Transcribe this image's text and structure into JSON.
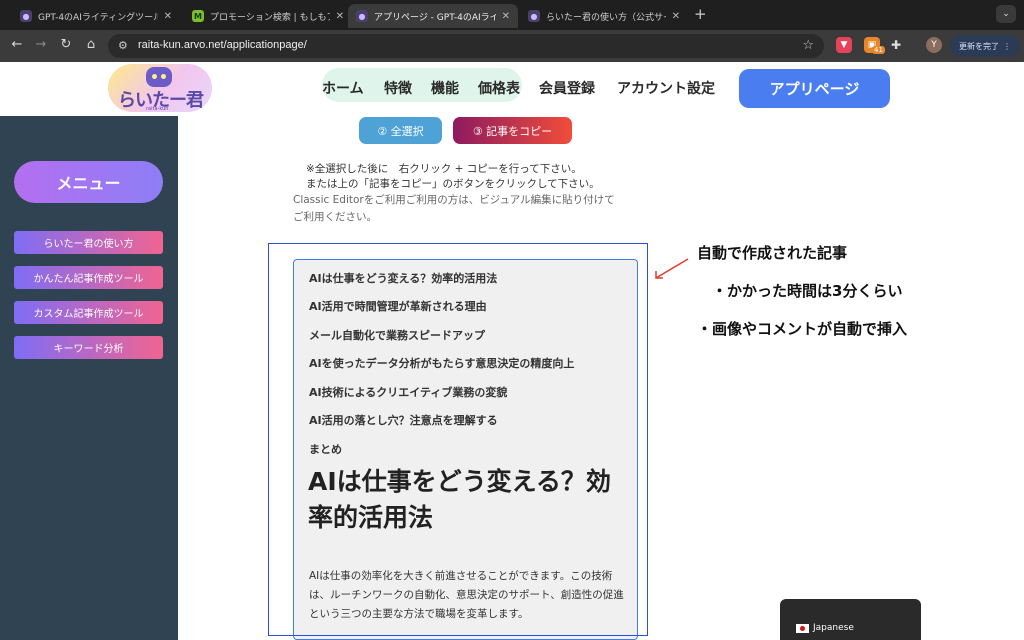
{
  "browser": {
    "tabs": [
      {
        "title": "GPT-4のAIライティングツール",
        "icon": "robot-favicon"
      },
      {
        "title": "プロモーション検索 | もしもアフ",
        "icon": "m-favicon"
      },
      {
        "title": "アプリページ - GPT-4のAIライティ",
        "icon": "robot-favicon"
      },
      {
        "title": "らいたー君の使い方（公式サイト",
        "icon": "robot-favicon"
      }
    ],
    "url": "raita-kun.arvo.net/applicationpage/",
    "extension_badge": "41",
    "avatar_letter": "Y",
    "update_button": "更新を完了"
  },
  "header": {
    "logo_text": "らいたー君",
    "logo_subtext": "raita-kun",
    "nav": [
      "ホーム",
      "特徴",
      "機能",
      "価格表",
      "会員登録",
      "アカウント設定"
    ],
    "app_button": "アプリページ"
  },
  "sidebar": {
    "menu_title": "メニュー",
    "items": [
      "らいたー君の使い方",
      "かんたん記事作成ツール",
      "カスタム記事作成ツール",
      "キーワード分析"
    ]
  },
  "main": {
    "select_all_button": "② 全選択",
    "copy_button": "③ 記事をコピー",
    "notes": [
      "※全選択した後に　右クリック + コピーを行って下さい。",
      "または上の「記事をコピー」のボタンをクリックして下さい。"
    ],
    "classic_note": [
      "Classic Editorをご利用ご利用の方は、ビジュアル編集に貼り付けて",
      "ご利用ください。"
    ],
    "toc": [
      "AIは仕事をどう変える？効率的活用法",
      "AI活用で時間管理が革新される理由",
      "メール自動化で業務スピードアップ",
      "AIを使ったデータ分析がもたらす意思決定の精度向上",
      "AI技術によるクリエイティブ業務の変貌",
      "AI活用の落とし穴？注意点を理解する",
      "まとめ"
    ],
    "article_title": "AIは仕事をどう変える？効率的活用法",
    "article_body": "AIは仕事の効率化を大きく前進させることができます。この技術は、ルーチンワークの自動化、意思決定のサポート、創造性の促進という三つの主要な方法で職場を変革します。"
  },
  "annotations": [
    "自動で作成された記事",
    "・かかった時間は3分くらい",
    "・画像やコメントが自動で挿入"
  ],
  "language_widget": {
    "label": "Japanese"
  },
  "colors": {
    "sidebar_bg": "#2f4353",
    "app_button": "#4a7df0",
    "highlight_border": "#2a4fd8",
    "annotation_arrow": "#e03a2a"
  }
}
